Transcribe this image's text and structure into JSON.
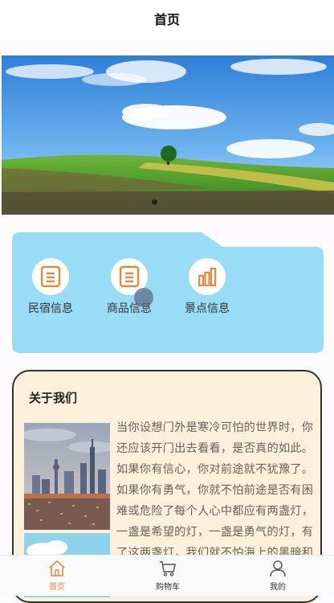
{
  "header": {
    "title": "首页"
  },
  "categories": [
    {
      "label": "民宿信息",
      "icon": "document-icon"
    },
    {
      "label": "商品信息",
      "icon": "document-icon"
    },
    {
      "label": "景点信息",
      "icon": "bar-chart-icon"
    }
  ],
  "about": {
    "title": "关于我们",
    "text": "当你设想门外是寒冷可怕的世界时，你还应该开门出去看看，是否真的如此。如果你有信心，你对前途就不犹豫了。如果你有勇气，你就不怕前途是否有困难或危险了每个人心中都应有两盏灯，一盏是希望的灯，一盏是勇气的灯，有了这两盏灯，我们就不怕海上的黑暗和风涛的险恶了。"
  },
  "tabs": [
    {
      "label": "首页",
      "icon": "home-icon",
      "active": true
    },
    {
      "label": "购物车",
      "icon": "cart-icon",
      "active": false
    },
    {
      "label": "我的",
      "icon": "user-icon",
      "active": false
    }
  ],
  "colors": {
    "accent": "#e58a3c",
    "panel": "#98dcf5",
    "about_bg": "#fdf1dc"
  }
}
